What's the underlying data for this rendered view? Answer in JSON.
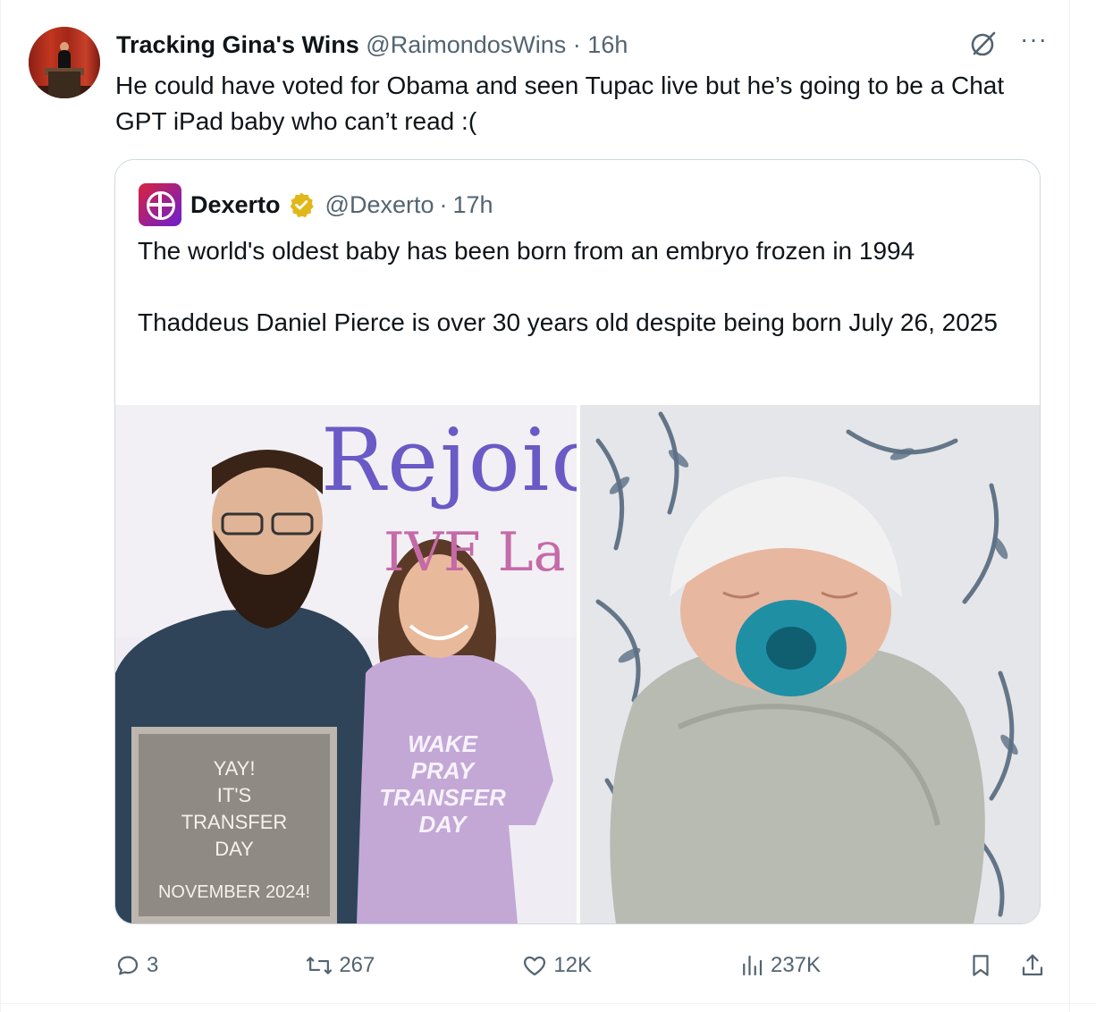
{
  "tweet": {
    "author_name": "Tracking Gina's Wins",
    "handle": "@RaimondosWins",
    "separator": "·",
    "time": "16h",
    "text": "He could have voted for Obama and seen Tupac live but he’s going to be a Chat GPT iPad baby who can’t read :("
  },
  "quote": {
    "author_name": "Dexerto",
    "handle": "@Dexerto",
    "separator": "·",
    "time": "17h",
    "paragraphs": [
      "The world's oldest baby has been born from an embryo frozen in 1994",
      "Thaddeus Daniel Pierce is over 30 years old despite being born July 26, 2025"
    ],
    "photo_left": {
      "sign_lines": [
        "YAY!",
        "IT'S",
        "TRANSFER",
        "DAY"
      ],
      "sign_footer": "NOVEMBER 2024!",
      "wall_logo_1": "Rejoice",
      "wall_logo_2": "IVF La",
      "shirt_lines": [
        "WAKE",
        "PRAY",
        "TRANSFER",
        "DAY"
      ]
    }
  },
  "actions": {
    "replies": "3",
    "retweets": "267",
    "likes": "12K",
    "views": "237K"
  },
  "icons": [
    "grok-icon",
    "more-icon",
    "verified-icon",
    "reply-icon",
    "retweet-icon",
    "like-icon",
    "views-icon",
    "bookmark-icon",
    "share-icon"
  ],
  "colors": {
    "text": "#0f1419",
    "muted": "#536471",
    "border": "#cfd9de",
    "verified": "#e2b719"
  }
}
